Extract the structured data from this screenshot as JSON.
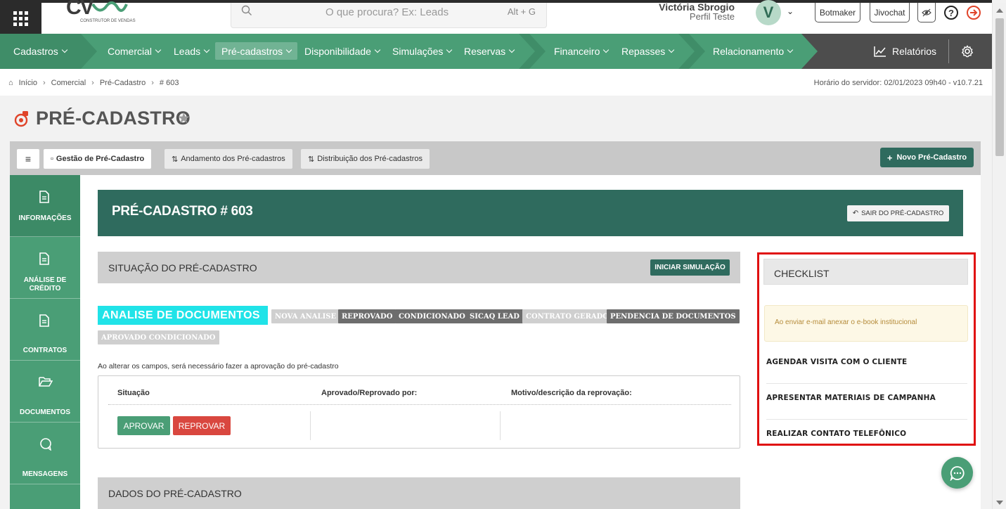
{
  "topbar": {
    "logo_text": "CV",
    "logo_subtitle": "CONSTRUTOR DE VENDAS",
    "search_placeholder": "O que procura? Ex: Leads",
    "search_shortcut": "Alt + G",
    "user_name": "Victória Sbrogio",
    "user_profile": "Perfil Teste",
    "avatar_letter": "V",
    "botmaker": "Botmaker",
    "jivochat": "Jivochat",
    "help": "?"
  },
  "nav": {
    "items": [
      {
        "label": "Cadastros"
      },
      {
        "label": "Comercial"
      },
      {
        "label": "Leads"
      },
      {
        "label": "Pré-cadastros"
      },
      {
        "label": "Disponibilidade"
      },
      {
        "label": "Simulações"
      },
      {
        "label": "Reservas"
      },
      {
        "label": "Financeiro"
      },
      {
        "label": "Repasses"
      },
      {
        "label": "Relacionamento"
      },
      {
        "label": "Relatórios"
      }
    ]
  },
  "breadcrumb": {
    "items": [
      "Início",
      "Comercial",
      "Pré-Cadastro",
      "# 603"
    ],
    "server_time": "Horário do servidor: 02/01/2023 09h40 - v10.7.21"
  },
  "page": {
    "title": "PRÉ-CADASTRO"
  },
  "tabs": {
    "items": [
      {
        "label": "Gestão de Pré-Cadastro"
      },
      {
        "label": "Andamento dos Pré-cadastros"
      },
      {
        "label": "Distribuição dos Pré-cadastros"
      }
    ],
    "new_button": "Novo Pré-Cadastro"
  },
  "sidenav": {
    "items": [
      {
        "label": "INFORMAÇÕES"
      },
      {
        "label": "ANÁLISE DE CRÉDITO"
      },
      {
        "label": "CONTRATOS"
      },
      {
        "label": "DOCUMENTOS"
      },
      {
        "label": "MENSAGENS"
      }
    ]
  },
  "record": {
    "title": "PRÉ-CADASTRO # 603",
    "exit_button": "SAIR DO PRÉ-CADASTRO"
  },
  "situation": {
    "section_title": "SITUAÇÃO DO PRÉ-CADASTRO",
    "sim_button": "INICIAR SIMULAÇÃO",
    "current_status": "ANALISE DE DOCUMENTOS",
    "statuses": [
      "NOVA ANALISE",
      "REPROVADO",
      "CONDICIONADO",
      "SICAQ LEAD",
      "CONTRATO GERADO",
      "PENDENCIA DE DOCUMENTOS",
      "APROVADO CONDICIONADO"
    ],
    "note": "Ao alterar os campos, será necessário fazer a aprovação do pré-cadastro",
    "col_situacao": "Situação",
    "col_aprovado": "Aprovado/Reprovado por:",
    "col_motivo": "Motivo/descrição da reprovação:",
    "approve_button": "APROVAR",
    "reject_button": "REPROVAR"
  },
  "dados": {
    "section_title": "DADOS DO PRÉ-CADASTRO"
  },
  "checklist": {
    "title": "CHECKLIST",
    "alert": "Ao enviar e-mail anexar o e-book institucional",
    "items": [
      "AGENDAR VISITA COM O CLIENTE",
      "APRESENTAR MATERIAIS DE CAMPANHA",
      "REALIZAR CONTATO TELEFÔNICO"
    ]
  },
  "colors": {
    "brand_green": "#4a9e76",
    "dark_green": "#2f6b5e",
    "highlight_status": "#20e3e8",
    "reject_red": "#d9473f",
    "checklist_outline": "#e01010"
  }
}
